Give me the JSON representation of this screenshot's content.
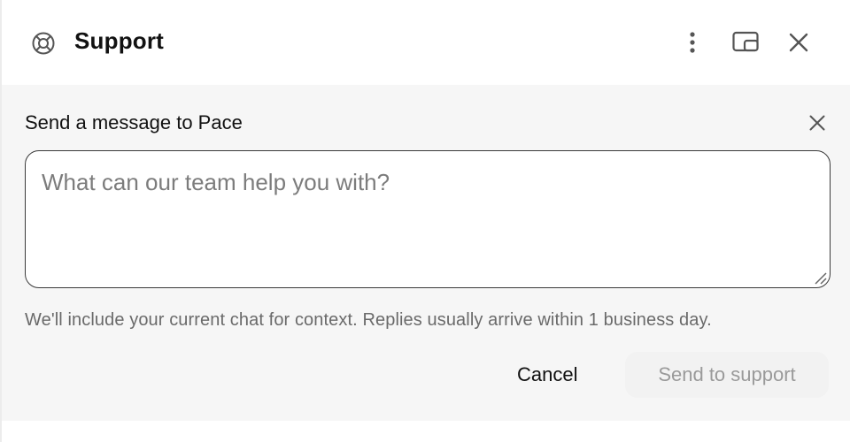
{
  "header": {
    "title": "Support",
    "icon": "lifebuoy-icon",
    "actions": [
      {
        "name": "more-options",
        "icon": "vertical-ellipsis-icon"
      },
      {
        "name": "popout",
        "icon": "popout-window-icon"
      },
      {
        "name": "close",
        "icon": "close-icon"
      }
    ]
  },
  "form": {
    "title": "Send a message to Pace",
    "message_placeholder": "What can our team help you with?",
    "message_value": "",
    "hint": "We'll include your current chat for context. Replies usually arrive within 1 business day.",
    "cancel_label": "Cancel",
    "send_label": "Send to support",
    "send_disabled": true
  },
  "colors": {
    "panel_background": "#f6f6f6",
    "text": "#111111",
    "muted_text": "#6a6a6a",
    "disabled_text": "#9a9a9a",
    "input_border": "#3a3a3a"
  }
}
